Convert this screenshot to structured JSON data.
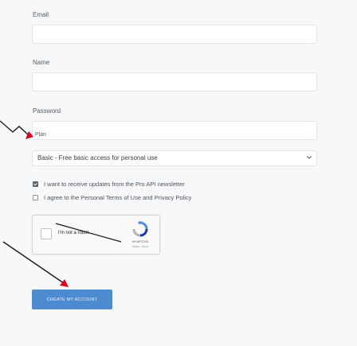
{
  "form": {
    "email_label": "Email",
    "name_label": "Name",
    "password_label": "Password",
    "plan_label": "Plan",
    "plan_selected": "Basic - Free basic access for personal use",
    "newsletter_label": "I want to receive updates from the Pro API newsletter",
    "terms_label": "I agree to the Personal Terms of Use and Privacy Policy",
    "submit_label": "CREATE MY ACCOUNT"
  },
  "captcha": {
    "label": "I'm not a robot",
    "brand": "reCAPTCHA",
    "links": "Privacy - Terms"
  },
  "checkboxes": {
    "newsletter_checked": true,
    "terms_checked": false
  },
  "colors": {
    "submit_button": "#4c8bd0",
    "annotation_arrow": "#e3001b"
  },
  "icons": {
    "select_arrow": "chevron-down-icon",
    "captcha_logo": "recaptcha-icon"
  }
}
